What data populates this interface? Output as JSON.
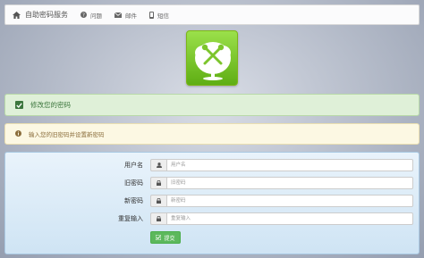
{
  "navbar": {
    "brand": "自助密码服务",
    "items": [
      {
        "label": "问题",
        "icon": "question-circle-icon"
      },
      {
        "label": "邮件",
        "icon": "envelope-icon"
      },
      {
        "label": "短信",
        "icon": "mobile-phone-icon"
      }
    ]
  },
  "logo": {
    "icon": "tree-tools-logo"
  },
  "alerts": {
    "success": "修改您的密码",
    "warning": "输入您的旧密码并设置新密码"
  },
  "form": {
    "fields": [
      {
        "label": "用户名",
        "placeholder": "用户名",
        "icon": "user-icon"
      },
      {
        "label": "旧密码",
        "placeholder": "旧密码",
        "icon": "lock-icon"
      },
      {
        "label": "新密码",
        "placeholder": "新密码",
        "icon": "lock-icon"
      },
      {
        "label": "重复输入",
        "placeholder": "重复输入",
        "icon": "lock-icon"
      }
    ],
    "submit_label": "提交"
  },
  "colors": {
    "success_bg": "#dff0d8",
    "warning_bg": "#fcf8e3",
    "panel_bg": "#e9f3fb",
    "button": "#5cb85c",
    "logo_green": "#7cc52c"
  }
}
